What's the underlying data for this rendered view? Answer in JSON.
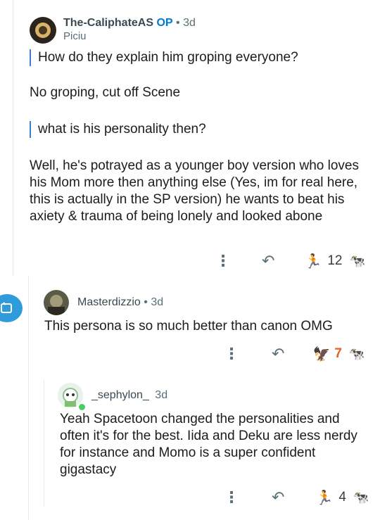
{
  "comment1": {
    "username": "The-CaliphateAS",
    "op_badge": "OP",
    "separator": "•",
    "time": "3d",
    "flair": "Piciu",
    "quote1": "How do they explain him groping everyone?",
    "reply1": "No groping, cut off Scene",
    "quote2": "what is his personality then?",
    "reply2": "Well, he's potrayed as a younger boy version who loves his Mom more then anything else (Yes, im for real here, this is actually in the SP version) he wants to beat his axiety & trauma of being lonely and looked abone",
    "score": "12"
  },
  "comment2": {
    "username": "Masterdizzio",
    "separator": "•",
    "time": "3d",
    "body": "This persona is so much better than canon OMG",
    "score": "7"
  },
  "comment3": {
    "username": "_sephylon_",
    "time": "3d",
    "body": "Yeah Spacetoon changed the personalities and often it's for the best. Iida and Deku are less nerdy for instance and Momo is a super confident gigastacy",
    "score": "4"
  },
  "colors": {
    "op": "#0079d3",
    "quote_bar": "#3d7ccf",
    "score_orange": "#e8601a"
  }
}
